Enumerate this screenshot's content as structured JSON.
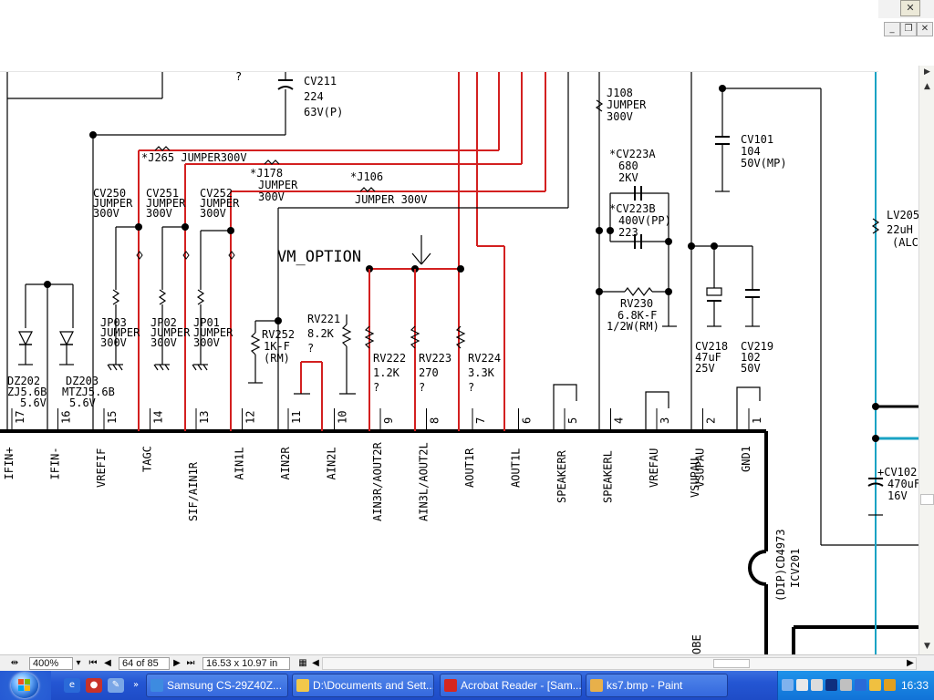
{
  "window": {
    "close_glyph": "✕",
    "doc_min_glyph": "_",
    "doc_restore_glyph": "❐",
    "doc_close_glyph": "✕"
  },
  "schematic": {
    "pins": [
      {
        "num": "17",
        "name": "IFIN+"
      },
      {
        "num": "16",
        "name": "IFIN-"
      },
      {
        "num": "15",
        "name": "VREFIF"
      },
      {
        "num": "14",
        "name": "TAGC"
      },
      {
        "num": "13",
        "name": "SIF/AIN1R"
      },
      {
        "num": "12",
        "name": "AIN1L"
      },
      {
        "num": "11",
        "name": "AIN2R"
      },
      {
        "num": "10",
        "name": "AIN2L"
      },
      {
        "num": "9",
        "name": "AIN3R/AOUT2R"
      },
      {
        "num": "8",
        "name": "AIN3L/AOUT2L"
      },
      {
        "num": "7",
        "name": "AOUT1R"
      },
      {
        "num": "6",
        "name": "AOUT1L"
      },
      {
        "num": "5",
        "name": "SPEAKERR"
      },
      {
        "num": "4",
        "name": "SPEAKERL"
      },
      {
        "num": "3",
        "name": "VREFAU"
      },
      {
        "num": "2",
        "name": "VSUPAU"
      },
      {
        "num": "1",
        "name": "GND1"
      }
    ],
    "labels": {
      "cv211": "CV211",
      "cv211_v": "224",
      "cv211_r": "63V(P)",
      "q_top": "?",
      "j108": "J108",
      "j108_a": "JUMPER",
      "j108_b": "300V",
      "cv101": "CV101",
      "cv101_v": "104",
      "cv101_r": "50V(MP)",
      "j265": "*J265 JUMPER300V",
      "j178": "*J178",
      "j178_a": "JUMPER",
      "j178_b": "300V",
      "j106": "*J106",
      "j106_a": "JUMPER 300V",
      "cv223a": "*CV223A",
      "cv223a_v": "680",
      "cv223a_r": "2KV",
      "cv223b": "*CV223B",
      "cv223b_v": "400V(PP)",
      "cv223b_c": "223",
      "cv250": "CV250",
      "cv250_a": "JUMPER",
      "cv250_b": "300V",
      "cv251": "CV251",
      "cv251_a": "JUMPER",
      "cv251_b": "300V",
      "cv252": "CV252",
      "cv252_a": "JUMPER",
      "cv252_b": "300V",
      "vm_option": "VM_OPTION",
      "lv205": "LV205",
      "lv205_v": "22uH",
      "lv205_c": "(ALC",
      "rv221": "RV221",
      "rv221_v": "8.2K",
      "rv221_q": "?",
      "rv230": "RV230",
      "rv230_v": "6.8K-F",
      "rv230_r": "1/2W(RM)",
      "jp03": "JP03",
      "jp03_a": "JUMPER",
      "jp03_b": "300V",
      "jp02": "JP02",
      "jp02_a": "JUMPER",
      "jp02_b": "300V",
      "jp01": "JP01",
      "jp01_a": "JUMPER",
      "jp01_b": "300V",
      "rv252": "RV252",
      "rv252_v": "1K-F",
      "rv252_r": "(RM)",
      "rv222": "RV222",
      "rv222_v": "1.2K",
      "rv222_q": "?",
      "rv223": "RV223",
      "rv223_v": "270",
      "rv223_q": "?",
      "rv224": "RV224",
      "rv224_v": "3.3K",
      "rv224_q": "?",
      "cv218": "CV218",
      "cv218_v": "47uF",
      "cv218_r": "25V",
      "cv219": "CV219",
      "cv219_v": "102",
      "cv219_r": "50V",
      "dz202": "DZ202",
      "dz202_t": "ZJ5.6B",
      "dz202_v": "5.6V",
      "dz203": "DZ203",
      "dz203_t": "MTZJ5.6B",
      "dz203_v": "5.6V",
      "cv102": "+CV102",
      "cv102_v": "470uF",
      "cv102_r": "16V",
      "ic_type": "(DIP)CD4973",
      "ic_ref": "ICV201",
      "pin_cut": "OBE",
      "vsup_overlap": "VSUPAU"
    }
  },
  "statusbar": {
    "zoom": "400%",
    "page": "64 of 85",
    "size": "16.53 x 10.97 in"
  },
  "taskbar": {
    "tasks": [
      {
        "label": "Samsung CS-29Z40Z..."
      },
      {
        "label": "D:\\Documents and Sett..."
      },
      {
        "label": "Acrobat Reader - [Sam..."
      },
      {
        "label": "ks7.bmp - Paint"
      }
    ],
    "clock": "16:33",
    "chevron": "»"
  },
  "colors": {
    "wire": "#000000",
    "highlight": "#d32020",
    "cyan_wire": "#1aa3c4"
  }
}
